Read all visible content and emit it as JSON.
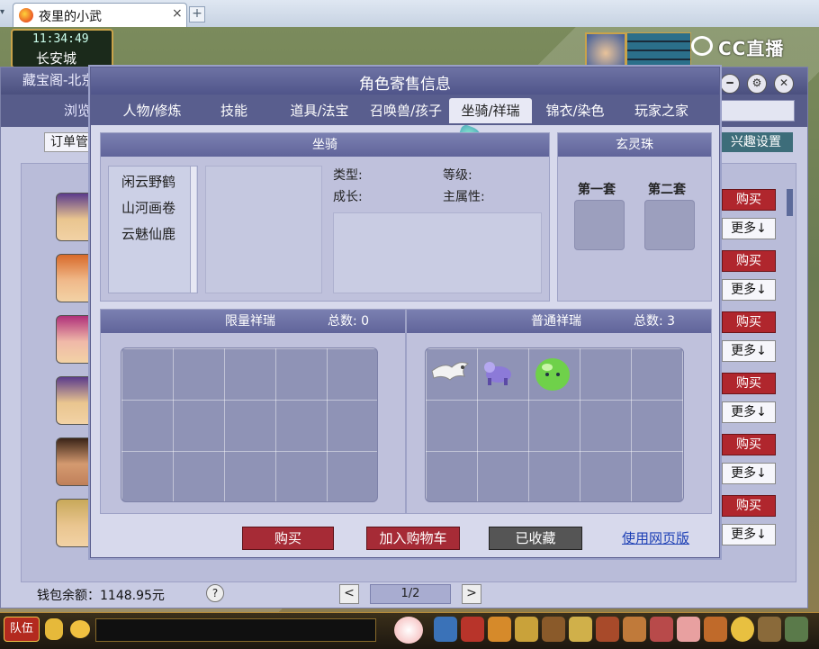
{
  "browser": {
    "tab_title": "夜里的小武",
    "close": "×",
    "new_tab": "+"
  },
  "scene": {
    "time": "11:34:49",
    "city": "长安城",
    "cc_logo_text": "CC直播"
  },
  "back_window": {
    "title": "藏宝阁-北京",
    "nav_item": "浏览",
    "filter_value": "订单管",
    "interest_label": "兴趣设置",
    "rows": [
      {
        "buy": "购买",
        "more": "更多↓"
      },
      {
        "buy": "购买",
        "more": "更多↓"
      },
      {
        "buy": "购买",
        "more": "更多↓"
      },
      {
        "buy": "购买",
        "more": "更多↓"
      },
      {
        "buy": "购买",
        "more": "更多↓"
      },
      {
        "buy": "购买",
        "more": "更多↓"
      }
    ],
    "wallet": "钱包余额：1148.95元",
    "help": "?",
    "pager": {
      "prev": "<",
      "page": "1/2",
      "next": ">"
    }
  },
  "modal": {
    "title": "角色寄售信息",
    "tabs": [
      "人物/修炼",
      "技能",
      "道具/法宝",
      "召唤兽/孩子",
      "坐骑/祥瑞",
      "锦衣/染色",
      "玩家之家"
    ],
    "active_tab": 4,
    "mount_panel": {
      "title": "坐骑",
      "items": [
        "闲云野鹤",
        "山河画卷",
        "云魅仙鹿"
      ],
      "type_label": "类型:",
      "level_label": "等级:",
      "growth_label": "成长:",
      "main_attr_label": "主属性:"
    },
    "pearl_panel": {
      "title": "玄灵珠",
      "set1": "第一套",
      "set2": "第二套"
    },
    "limited_panel": {
      "title": "限量祥瑞",
      "total": "总数: 0"
    },
    "normal_panel": {
      "title": "普通祥瑞",
      "total": "总数: 3"
    },
    "buttons": {
      "buy": "购买",
      "add_cart": "加入购物车",
      "favorited": "已收藏",
      "web_version": "使用网页版"
    }
  },
  "taskbar": {
    "team": "队伍"
  }
}
